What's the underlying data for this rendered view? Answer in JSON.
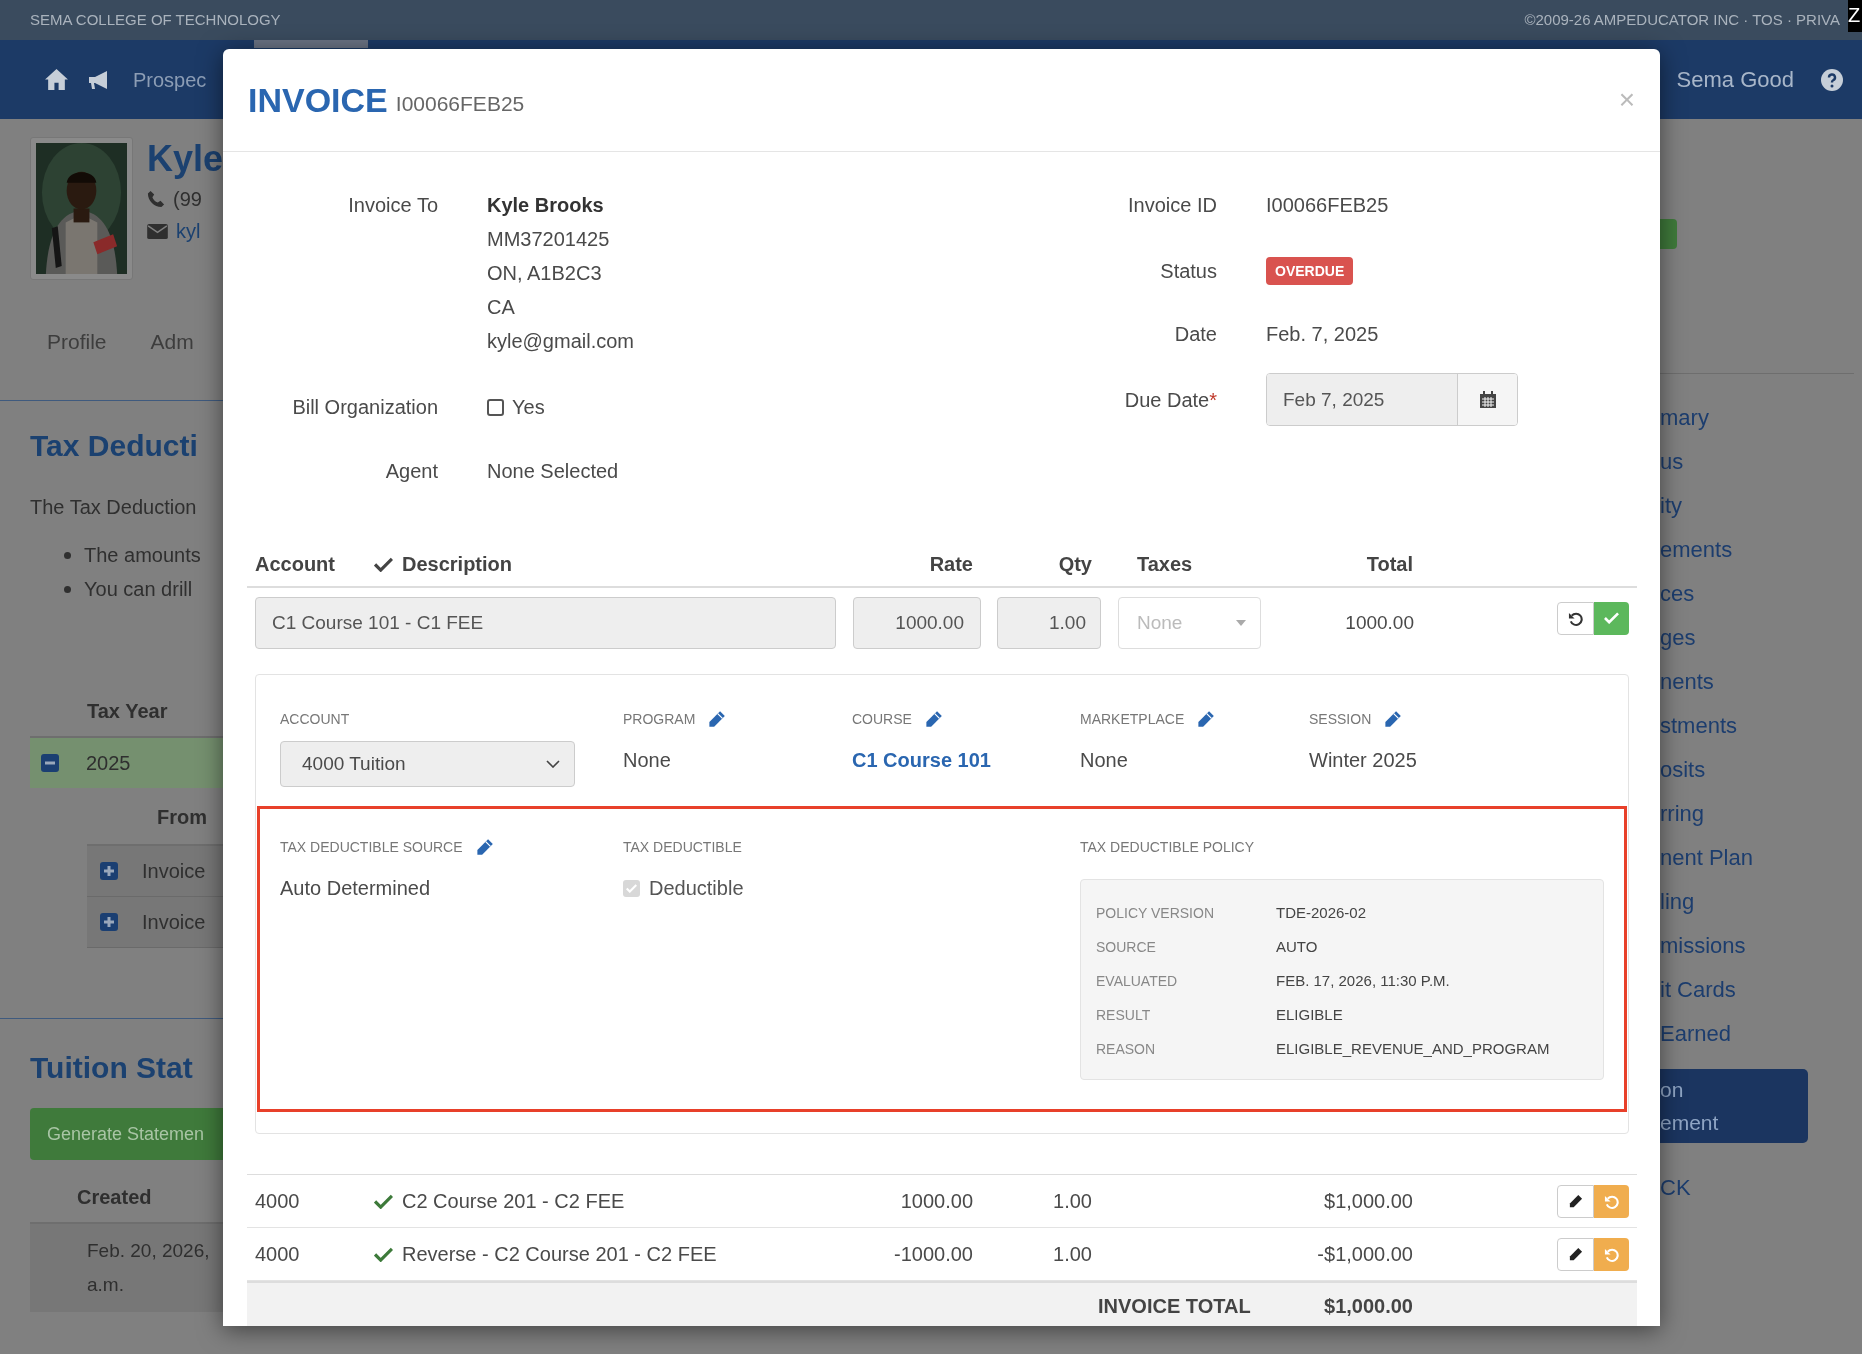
{
  "top_strip": {
    "school": "SEMA COLLEGE OF TECHNOLOGY",
    "legal": "©2009-26 AMPEDUCATOR INC · TOS · PRIVA",
    "corner": "Z"
  },
  "nav": {
    "items": [
      {
        "label": "Prospec"
      }
    ],
    "user": "Sema Good"
  },
  "profile": {
    "name": "Kyle",
    "phone": "(99",
    "email": "kyl"
  },
  "profile_tabs": [
    {
      "label": "Profile"
    },
    {
      "label": "Adm"
    }
  ],
  "tax_section": {
    "title": "Tax Deducti",
    "intro": "The Tax Deduction",
    "bullets": [
      "The amounts",
      "You can drill"
    ],
    "column": "Tax Year",
    "rows": [
      {
        "year": "2025",
        "expanded": true,
        "sub_column": "From",
        "children": [
          {
            "label": "Invoice",
            "expanded": false
          },
          {
            "label": "Invoice",
            "expanded": false
          }
        ]
      }
    ]
  },
  "tuition_section": {
    "title": "Tuition Stat",
    "button": "Generate Statemen",
    "column": "Created",
    "rows": [
      {
        "lines": [
          "Feb. 20, 2026,",
          "a.m."
        ]
      }
    ]
  },
  "side_menu": {
    "items": [
      {
        "label": "mary",
        "selected": false
      },
      {
        "label": "us",
        "selected": false
      },
      {
        "label": "ity",
        "selected": false
      },
      {
        "label": "ements",
        "selected": false
      },
      {
        "label": "ces",
        "selected": false
      },
      {
        "label": "ges",
        "selected": false
      },
      {
        "label": "nents",
        "selected": false
      },
      {
        "label": "stments",
        "selected": false
      },
      {
        "label": "osits",
        "selected": false
      },
      {
        "label": "rring",
        "selected": false
      },
      {
        "label": "nent Plan",
        "selected": false
      },
      {
        "label": "ling",
        "selected": false
      },
      {
        "label": "missions",
        "selected": false
      },
      {
        "label": "it Cards",
        "selected": false
      },
      {
        "label": "Earned",
        "selected": false
      },
      {
        "label": "on\nement",
        "selected": true
      }
    ],
    "footer": "CK"
  },
  "modal": {
    "title": "INVOICE",
    "number": "I00066FEB25",
    "close": "×",
    "invoice_to": {
      "label": "Invoice To",
      "name": "Kyle Brooks",
      "lines": [
        "MM37201425",
        "ON, A1B2C3",
        "CA",
        "kyle@gmail.com"
      ]
    },
    "bill_organization": {
      "label": "Bill Organization",
      "option": "Yes",
      "checked": false
    },
    "agent": {
      "label": "Agent",
      "value": "None Selected"
    },
    "invoice_id": {
      "label": "Invoice ID",
      "value": "I00066FEB25"
    },
    "status": {
      "label": "Status",
      "value": "OVERDUE",
      "kind": "overdue"
    },
    "date": {
      "label": "Date",
      "value": "Feb. 7, 2025"
    },
    "due_date": {
      "label": "Due Date",
      "required_mark": "*",
      "value": "Feb 7, 2025"
    },
    "columns": {
      "account": "Account",
      "description": "Description",
      "rate": "Rate",
      "qty": "Qty",
      "taxes": "Taxes",
      "total": "Total"
    },
    "edit_row": {
      "description": "C1 Course 101 - C1 FEE",
      "rate": "1000.00",
      "qty": "1.00",
      "taxes_placeholder": "None",
      "total": "1000.00"
    },
    "detail": {
      "fields": [
        {
          "label": "ACCOUNT",
          "kind": "select",
          "value": "4000 Tuition"
        },
        {
          "label": "PROGRAM",
          "kind": "editable",
          "value": "None"
        },
        {
          "label": "COURSE",
          "kind": "link",
          "value": "C1 Course 101"
        },
        {
          "label": "MARKETPLACE",
          "kind": "editable",
          "value": "None"
        },
        {
          "label": "SESSION",
          "kind": "editable",
          "value": "Winter 2025"
        }
      ],
      "tax_source": {
        "label": "TAX DEDUCTIBLE SOURCE",
        "value": "Auto Determined"
      },
      "tax_deductible": {
        "label": "TAX DEDUCTIBLE",
        "option": "Deductible",
        "checked": true,
        "disabled": true
      },
      "policy": {
        "label": "TAX DEDUCTIBLE POLICY",
        "rows": [
          {
            "label": "POLICY VERSION",
            "value": "TDE-2026-02"
          },
          {
            "label": "SOURCE",
            "value": "AUTO"
          },
          {
            "label": "EVALUATED",
            "value": "FEB. 17, 2026, 11:30 P.M."
          },
          {
            "label": "RESULT",
            "value": "ELIGIBLE"
          },
          {
            "label": "REASON",
            "value": "ELIGIBLE_REVENUE_AND_PROGRAM"
          }
        ]
      }
    },
    "rows": [
      {
        "account": "4000",
        "approved": true,
        "description": "C2 Course 201 - C2 FEE",
        "rate": "1000.00",
        "qty": "1.00",
        "total": "$1,000.00"
      },
      {
        "account": "4000",
        "approved": true,
        "description": "Reverse - C2 Course 201 - C2 FEE",
        "rate": "-1000.00",
        "qty": "1.00",
        "total": "-$1,000.00"
      }
    ],
    "invoice_total": {
      "label": "INVOICE TOTAL",
      "value": "$1,000.00"
    }
  }
}
